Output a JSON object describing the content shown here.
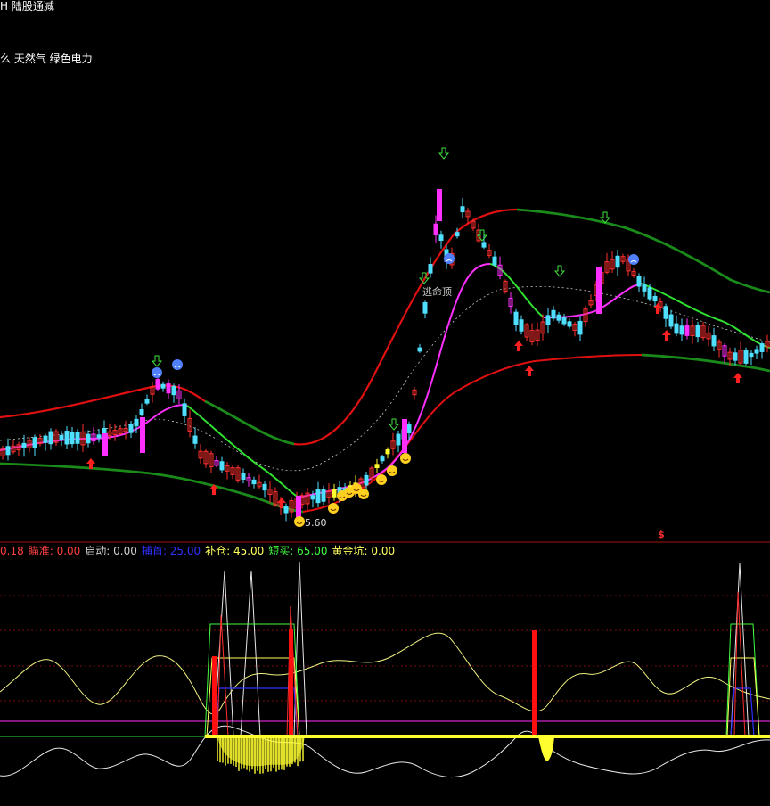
{
  "header": {
    "title": "H 陆股通减",
    "sector": "么 天然气 绿色电力"
  },
  "main_chart": {
    "low_price_label": "5.60",
    "annotation": "逃命顶",
    "signal_marker": "$",
    "colors": {
      "upper_band": "#e01010",
      "upper_band_alt": "#1a8a1a",
      "mid_line": "#ff30ff",
      "mid_line_alt": "#30e030",
      "lower_band": "#1a8a1a",
      "lower_band_alt": "#e01010",
      "candle_up": "#ff3030",
      "candle_down": "#4fe0ff",
      "candle_highlight": "#ff30ff",
      "candle_yellow": "#ffff30",
      "dashed_ma": "#c8c8c8"
    }
  },
  "indicator": {
    "items": [
      {
        "label": "0.18",
        "color": "#ff4040"
      },
      {
        "label": "瞄准: 0.00",
        "color": "#ff4040"
      },
      {
        "label": "启动: 0.00",
        "color": "#d0d0d0"
      },
      {
        "label": "捕首: 25.00",
        "color": "#3030ff"
      },
      {
        "label": "补仓: 45.00",
        "color": "#ffff60"
      },
      {
        "label": "短买: 65.00",
        "color": "#40ff40"
      },
      {
        "label": "黄金坑: 0.00",
        "color": "#ffff60"
      }
    ]
  }
}
